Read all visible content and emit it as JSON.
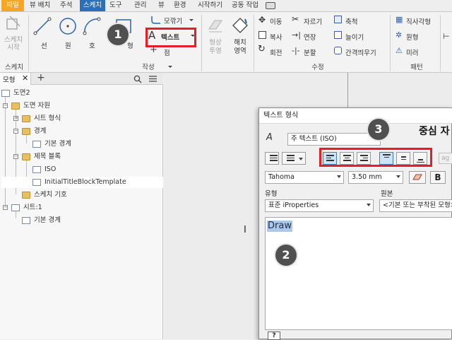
{
  "menu": {
    "file": "파일",
    "items": [
      "뷰 배치",
      "주석",
      "스케치",
      "도구",
      "관리",
      "뷰",
      "환경",
      "시작하기",
      "공동 작업"
    ],
    "active": "스케치"
  },
  "ribbon": {
    "sketch_start": "스케치\n시작",
    "line": "선",
    "circle": "원",
    "arc": "호",
    "rect_partial": "형",
    "fillet": "모깎기",
    "text": "텍스트",
    "point": "점",
    "project": "형상\n투영",
    "fill": "해치\n영역",
    "move": "이동",
    "copy": "복사",
    "rotate": "회전",
    "trim": "자르기",
    "extend": "연장",
    "split": "분할",
    "scale": "축척",
    "stretch": "늘이기",
    "offset": "간격띄우기",
    "rect_array": "직사각형",
    "circ_array": "원형",
    "mirror": "미러",
    "group_sketch": "스케치",
    "group_create": "작성",
    "group_modify": "수정",
    "group_pattern": "패턴"
  },
  "panel": {
    "tab": "모형",
    "tree": [
      {
        "label": "도면2"
      },
      {
        "label": "도면 자원"
      },
      {
        "label": "시트 형식"
      },
      {
        "label": "경계"
      },
      {
        "label": "기본 경계"
      },
      {
        "label": "제목 블록"
      },
      {
        "label": "ISO"
      },
      {
        "label": "InitialTitleBlockTemplate"
      },
      {
        "label": "스케치 기호"
      },
      {
        "label": "시트:1"
      },
      {
        "label": "기본 경계"
      }
    ]
  },
  "dialog": {
    "title": "텍스트 형식",
    "style_value": "주 텍스트 (ISO)",
    "font_value": "Tahoma",
    "size_value": "3.50 mm",
    "type_label": "유형",
    "type_value": "표준 iProperties",
    "source_label": "원본",
    "source_value": "<기본 또는 부착된 모형>",
    "bold": "B",
    "text_content": "Draw",
    "header_partial": "중심 자",
    "help": "?"
  },
  "callouts": [
    "1",
    "2",
    "3"
  ],
  "colors": {
    "active_tab": "#2b6fbb",
    "file_tab": "#f5a623",
    "highlight_box": "#e01f26",
    "selection": "#a9c8ea",
    "callout": "#505050"
  }
}
